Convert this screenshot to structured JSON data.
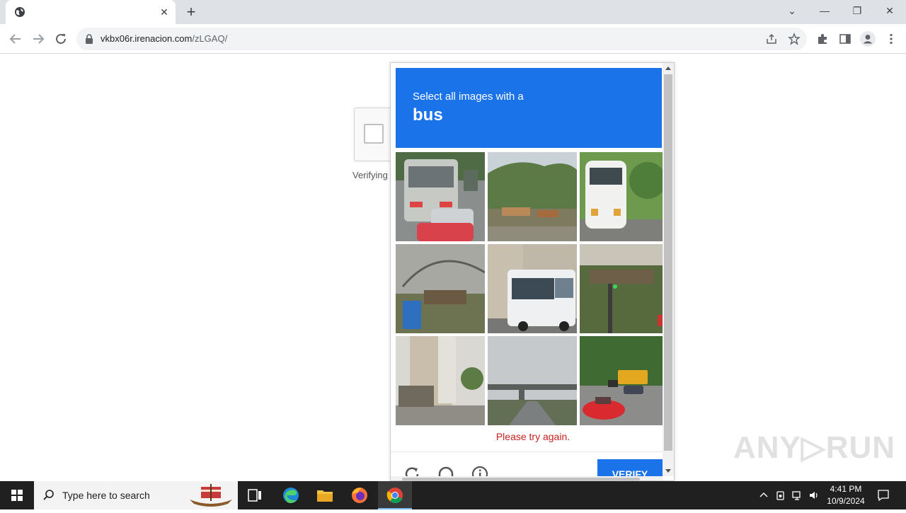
{
  "browser": {
    "tab_close_glyph": "✕",
    "new_tab_glyph": "+",
    "url_domain": "vkbx06r.irenacion.com",
    "url_path": "/zLGAQ/",
    "window_buttons": {
      "dropdown": "⌄",
      "minimize": "—",
      "restore": "❐",
      "close": "✕"
    }
  },
  "page": {
    "verifying_text": "Verifying"
  },
  "challenge": {
    "prompt": "Select all images with a",
    "target": "bus",
    "error": "Please try again.",
    "verify_label": "VERIFY",
    "tiles": [
      "Bus on a highway in traffic",
      "Mountain road with market stalls",
      "White bus on a tree-lined road",
      "Construction site with arched roof",
      "White bus on a city street",
      "Traffic light near a building",
      "Street with tall apartment building",
      "Highway overpass under cloudy sky",
      "School bus and red car on a road"
    ],
    "colors": {
      "accent": "#1a73e8",
      "error": "#c5221f"
    }
  },
  "watermark": "ANY▷RUN",
  "taskbar": {
    "search_placeholder": "Type here to search",
    "time": "4:41 PM",
    "date": "10/9/2024"
  }
}
